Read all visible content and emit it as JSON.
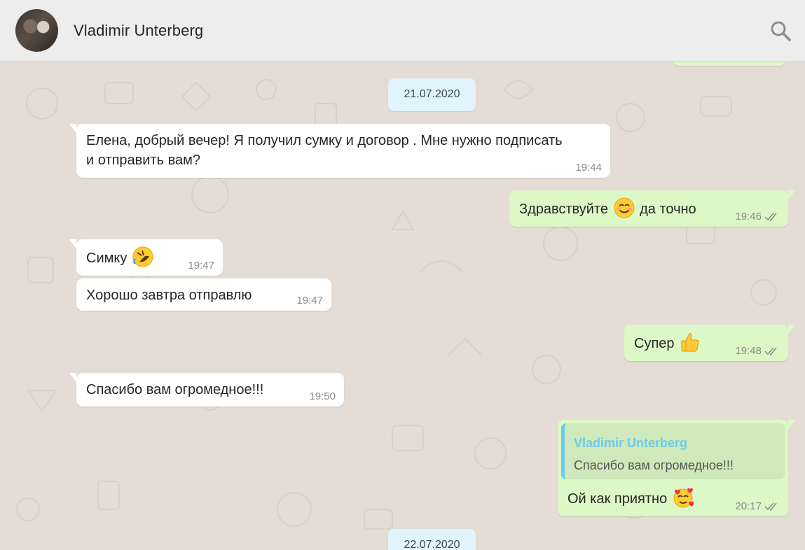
{
  "header": {
    "contact_name": "Vladimir Unterberg",
    "search_icon": "search-icon"
  },
  "colors": {
    "incoming_bubble": "#ffffff",
    "outgoing_bubble": "#dcf8c6",
    "date_chip": "#e1f3fb",
    "quote_accent": "#6bcbef",
    "read_ticks": "#8a8a8a"
  },
  "dates": [
    "21.07.2020",
    "22.07.2020"
  ],
  "messages": [
    {
      "direction": "in",
      "text_line1": "Елена, добрый вечер! Я получил сумку и  договор . Мне нужно подписать",
      "text_line2": "и отправить вам?",
      "time": "19:44"
    },
    {
      "direction": "out",
      "text_before": "Здравствуйте",
      "emoji": "smiling-face-emoji",
      "text_after": "да точно",
      "time": "19:46",
      "status": "read"
    },
    {
      "direction": "in",
      "text": "Симку",
      "emoji": "rolling-on-floor-laughing-emoji",
      "time": "19:47"
    },
    {
      "direction": "in",
      "text": "Хорошо завтра отправлю",
      "time": "19:47"
    },
    {
      "direction": "out",
      "text": "Супер",
      "emoji": "thumbs-up-emoji",
      "time": "19:48",
      "status": "read"
    },
    {
      "direction": "in",
      "text": "Спасибо вам огромедное!!!",
      "time": "19:50"
    },
    {
      "direction": "out",
      "quote_author": "Vladimir Unterberg",
      "quote_text": "Спасибо вам огромедное!!!",
      "text": "Ой как приятно",
      "emoji": "smiling-face-with-hearts-emoji",
      "time": "20:17",
      "status": "read"
    }
  ]
}
